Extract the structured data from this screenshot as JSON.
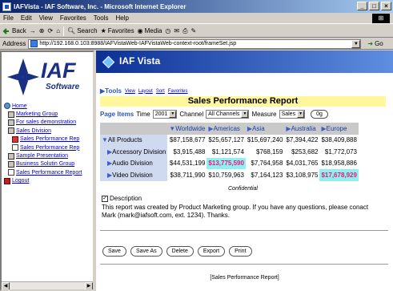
{
  "window": {
    "title": "IAFVista - IAF Software, Inc. - Microsoft Internet Explorer",
    "minimize": "_",
    "maximize": "□",
    "close": "×"
  },
  "menu": [
    "File",
    "Edit",
    "View",
    "Favorites",
    "Tools",
    "Help"
  ],
  "toolbar": {
    "back": "Back",
    "search": "Search",
    "favorites": "Favorites",
    "media": "Media"
  },
  "address": {
    "label": "Address",
    "url": "http://192.168.0.103:8988/IAFVistaWeb-IAFVistaWeb-context-root/frameSet.jsp",
    "go": "Go"
  },
  "sidebar": {
    "logo_text": "IAF",
    "logo_sub": "Software",
    "items": [
      {
        "label": "Home",
        "indent": 0,
        "icon": "home-icon"
      },
      {
        "label": "Marketing Group",
        "indent": 1,
        "icon": "folder-icon"
      },
      {
        "label": "For sales demonstration",
        "indent": 1,
        "icon": "folder-icon"
      },
      {
        "label": "Sales Division",
        "indent": 1,
        "icon": "folder-icon"
      },
      {
        "label": "Sales Performance Rep",
        "indent": 2,
        "icon": "report-icon"
      },
      {
        "label": "Sales Performance Rep",
        "indent": 2,
        "icon": "document-icon"
      },
      {
        "label": "Sample Presentation",
        "indent": 1,
        "icon": "folder-icon"
      },
      {
        "label": "Business Solutin Group",
        "indent": 1,
        "icon": "folder-icon"
      },
      {
        "label": "Sales Performance Report",
        "indent": 1,
        "icon": "document-icon"
      },
      {
        "label": "Logout",
        "indent": 0,
        "icon": "logout-icon"
      }
    ]
  },
  "banner": {
    "title": "IAF Vista"
  },
  "tools": {
    "label": "Tools",
    "links": [
      "View",
      "Layout",
      "Sort",
      "Favorites"
    ]
  },
  "report": {
    "title": "Sales Performance Report",
    "page_items_label": "Page Items",
    "time_label": "Time",
    "time_value": "2001",
    "channel_label": "Channel",
    "channel_value": "All Channels",
    "measure_label": "Measure",
    "measure_value": "Sales",
    "go_label": "0g",
    "columns": [
      "Worldwide",
      "Americas",
      "Asia",
      "Australia",
      "Europe"
    ],
    "rows": [
      {
        "label": "All Products",
        "values": [
          "$87,158,677",
          "$25,657,127",
          "$15,697,240",
          "$7,394,422",
          "$38,409,888"
        ],
        "highlight": -1
      },
      {
        "label": "Accessory Division",
        "values": [
          "$3,915,488",
          "$1,121,574",
          "$768,159",
          "$253,682",
          "$1,772,073"
        ],
        "highlight": -1
      },
      {
        "label": "Audio Division",
        "values": [
          "$44,531,199",
          "$13,775,590",
          "$7,764,958",
          "$4,031,765",
          "$18,958,886"
        ],
        "highlight": 1
      },
      {
        "label": "Video Division",
        "values": [
          "$38,711,990",
          "$10,759,963",
          "$7,164,123",
          "$3,108,975",
          "$17,678,929"
        ],
        "highlight": 4
      }
    ],
    "confidential": "Confidential",
    "description_label": "Description",
    "description_text": "This report was created by Product Marketing group. If you have any questions, please conact Mark (mark@iafsoft.com, ext. 1234). Thanks.",
    "buttons": [
      "Save",
      "Save As",
      "Delete",
      "Export",
      "Print"
    ],
    "footer": "[Sales Performance Report]"
  },
  "colors": {
    "banner": "#0c2f95",
    "title_bg": "#fff799",
    "highlight_bg": "#8ef0f0",
    "highlight_fg": "#e61a7a"
  }
}
